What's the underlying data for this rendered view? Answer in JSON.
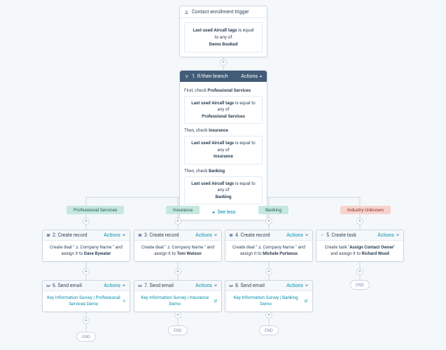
{
  "trigger": {
    "title": "Contact enrollment trigger",
    "tag_line": "is equal to any of",
    "tag_prefix": "Last used Aircall tags",
    "value": "Demo Booked"
  },
  "branch": {
    "title": "1. If/then branch",
    "actions": "Actions",
    "first_check": "First, check",
    "then_check": "Then, check",
    "tag_prefix": "Last used Aircall tags",
    "tag_line": "is equal to any of",
    "checks": [
      "Professional Services",
      "Insurance",
      "Banking"
    ],
    "see_less": "See less"
  },
  "pills": [
    "Professional Services",
    "Insurance",
    "Banking",
    "Industry Unknown"
  ],
  "records": [
    {
      "title": "2. Create record",
      "actions": "Actions",
      "pre": "Create deal \"",
      "mid": "Company Name",
      "suf": "\" and assign it to ",
      "assignee": "Dave Bywater"
    },
    {
      "title": "3. Create record",
      "actions": "Actions",
      "pre": "Create deal \"",
      "mid": "Company Name",
      "suf": "\" and assign it to ",
      "assignee": "Tom Watson"
    },
    {
      "title": "4. Create record",
      "actions": "Actions",
      "pre": "Create deal \"",
      "mid": "Company Name",
      "suf": "\" and assign it to ",
      "assignee": "Michele Porteous"
    }
  ],
  "task": {
    "title": "5. Create task",
    "actions": "Actions",
    "pre": "Create task \"",
    "name": "Assign Contact Owner",
    "suf": "\" and assign it to ",
    "assignee": "Richard Wood"
  },
  "emails": [
    {
      "title": "6. Send email",
      "actions": "Actions",
      "name": "Key Information Survey | Professional Services Demo"
    },
    {
      "title": "7. Send email",
      "actions": "Actions",
      "name": "Key Information Survey | Insurance Demo"
    },
    {
      "title": "8. Send email",
      "actions": "Actions",
      "name": "Key Information Survey | Banking Demo"
    }
  ],
  "end": "END",
  "chart_data": {
    "type": "diagram",
    "title": "HubSpot workflow: If/then branch on Last used Aircall tags",
    "nodes": [
      {
        "id": "trigger",
        "label": "Contact enrollment trigger",
        "condition": "Last used Aircall tags is equal to any of Demo Booked"
      },
      {
        "id": "branch",
        "label": "1. If/then branch",
        "checks": [
          "Professional Services",
          "Insurance",
          "Banking"
        ]
      },
      {
        "id": "r2",
        "label": "2. Create record",
        "assignee": "Dave Bywater",
        "branch": "Professional Services"
      },
      {
        "id": "r3",
        "label": "3. Create record",
        "assignee": "Tom Watson",
        "branch": "Insurance"
      },
      {
        "id": "r4",
        "label": "4. Create record",
        "assignee": "Michele Porteous",
        "branch": "Banking"
      },
      {
        "id": "t5",
        "label": "5. Create task",
        "task": "Assign Contact Owner",
        "assignee": "Richard Wood",
        "branch": "Industry Unknown"
      },
      {
        "id": "e6",
        "label": "6. Send email",
        "template": "Key Information Survey | Professional Services Demo"
      },
      {
        "id": "e7",
        "label": "7. Send email",
        "template": "Key Information Survey | Insurance Demo"
      },
      {
        "id": "e8",
        "label": "8. Send email",
        "template": "Key Information Survey | Banking Demo"
      }
    ],
    "edges": [
      [
        "trigger",
        "branch"
      ],
      [
        "branch",
        "r2"
      ],
      [
        "branch",
        "r3"
      ],
      [
        "branch",
        "r4"
      ],
      [
        "branch",
        "t5"
      ],
      [
        "r2",
        "e6"
      ],
      [
        "r3",
        "e7"
      ],
      [
        "r4",
        "e8"
      ],
      [
        "e6",
        "END"
      ],
      [
        "e7",
        "END"
      ],
      [
        "e8",
        "END"
      ],
      [
        "t5",
        "END"
      ]
    ]
  }
}
